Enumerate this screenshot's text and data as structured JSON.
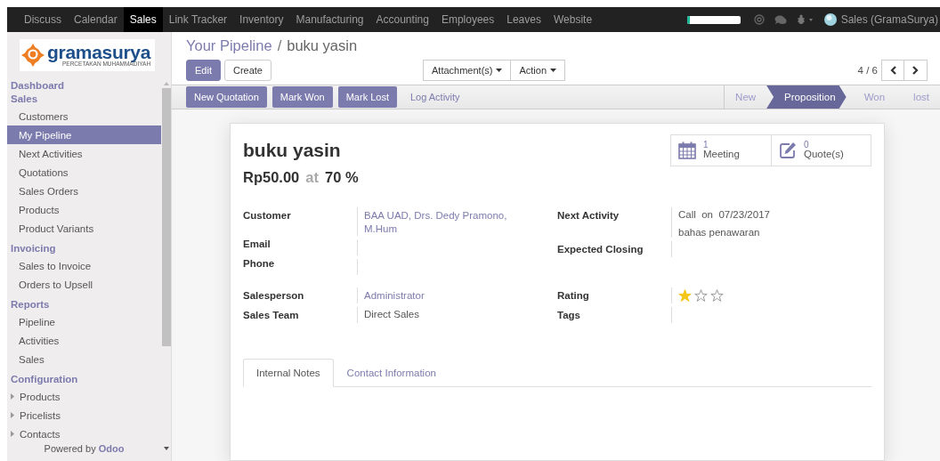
{
  "navbar": {
    "apps": [
      {
        "label": "Discuss",
        "selected": false
      },
      {
        "label": "Calendar",
        "selected": false
      },
      {
        "label": "Sales",
        "selected": true
      },
      {
        "label": "Link Tracker",
        "selected": false
      },
      {
        "label": "Inventory",
        "selected": false
      },
      {
        "label": "Manufacturing",
        "selected": false
      },
      {
        "label": "Accounting",
        "selected": false
      },
      {
        "label": "Employees",
        "selected": false
      },
      {
        "label": "Leaves",
        "selected": false
      },
      {
        "label": "Website",
        "selected": false
      }
    ],
    "planner": {
      "level": 0.06
    },
    "user": "Sales (GramaSurya)"
  },
  "sidebar": {
    "logo": {
      "name": "gramasurya",
      "tagline": "PERCETAKAN MUHAMMADIYAH"
    },
    "sections": [
      {
        "title": "Dashboard"
      },
      {
        "title": "Sales",
        "items": [
          {
            "label": "Customers",
            "selected": false,
            "kind": "leaf"
          },
          {
            "label": "My Pipeline",
            "selected": true,
            "kind": "leaf"
          },
          {
            "label": "Next Activities",
            "selected": false,
            "kind": "leaf"
          },
          {
            "label": "Quotations",
            "selected": false,
            "kind": "leaf"
          },
          {
            "label": "Sales Orders",
            "selected": false,
            "kind": "leaf"
          },
          {
            "label": "Products",
            "selected": false,
            "kind": "leaf"
          },
          {
            "label": "Product Variants",
            "selected": false,
            "kind": "leaf"
          }
        ]
      },
      {
        "title": "Invoicing",
        "items": [
          {
            "label": "Sales to Invoice",
            "selected": false,
            "kind": "leaf"
          },
          {
            "label": "Orders to Upsell",
            "selected": false,
            "kind": "leaf"
          }
        ]
      },
      {
        "title": "Reports",
        "items": [
          {
            "label": "Pipeline",
            "selected": false,
            "kind": "leaf"
          },
          {
            "label": "Activities",
            "selected": false,
            "kind": "leaf"
          },
          {
            "label": "Sales",
            "selected": false,
            "kind": "leaf"
          }
        ]
      },
      {
        "title": "Configuration",
        "items": [
          {
            "label": "Products",
            "selected": false,
            "kind": "folder"
          },
          {
            "label": "Pricelists",
            "selected": false,
            "kind": "folder"
          },
          {
            "label": "Contacts",
            "selected": false,
            "kind": "folder"
          }
        ]
      }
    ],
    "footer": "Powered by **Odoo**"
  },
  "breadcrumb": {
    "items": [
      "Your Pipeline",
      "buku yasin"
    ],
    "separator": "/"
  },
  "buttons": [
    "Edit",
    "Create"
  ],
  "dropdowns": [
    "Attachment(s)",
    "Action"
  ],
  "pager": "4 / 6",
  "header_buttons": [
    {
      "label": "New Quotation",
      "kind": "primary"
    },
    {
      "label": "Mark Won",
      "kind": "primary"
    },
    {
      "label": "Mark Lost",
      "kind": "primary"
    },
    {
      "label": "Log Activity",
      "kind": "link"
    }
  ],
  "stages": [
    {
      "label": "New",
      "selected": false
    },
    {
      "label": "Proposition",
      "selected": true
    },
    {
      "label": "Won",
      "selected": false
    },
    {
      "label": "lost",
      "selected": false
    }
  ],
  "form": {
    "title": "buku yasin",
    "amount": "Rp50.00",
    "at": "at",
    "probability": "70 %",
    "smart_buttons": [
      {
        "count": "1",
        "label": "Meeting",
        "kind": "calendar"
      },
      {
        "count": "0",
        "label": "Quote(s)",
        "kind": "edit"
      }
    ],
    "groups": [
      [
        {
          "label": "Customer",
          "kind": "link",
          "value": "BAA UAD, Drs. Dedy Pramono, M.Hum"
        },
        {
          "label": "Email",
          "kind": "empty"
        },
        {
          "label": "Phone",
          "kind": "empty"
        }
      ],
      [
        {
          "label": "Next Activity",
          "kind": "activity",
          "value": "Call  on  07/23/2017",
          "note": "bahas penawaran"
        },
        {
          "label": "Expected Closing",
          "kind": "empty"
        }
      ],
      [
        {
          "label": "Salesperson",
          "kind": "link",
          "value": "Administrator"
        },
        {
          "label": "Sales Team",
          "kind": "text",
          "value": "Direct Sales"
        }
      ],
      [
        {
          "label": "Rating",
          "kind": "stars",
          "stars": 1
        },
        {
          "label": "Tags",
          "kind": "empty"
        }
      ]
    ],
    "tabs": [
      {
        "label": "Internal Notes",
        "selected": true
      },
      {
        "label": "Contact Information",
        "selected": false
      }
    ]
  }
}
